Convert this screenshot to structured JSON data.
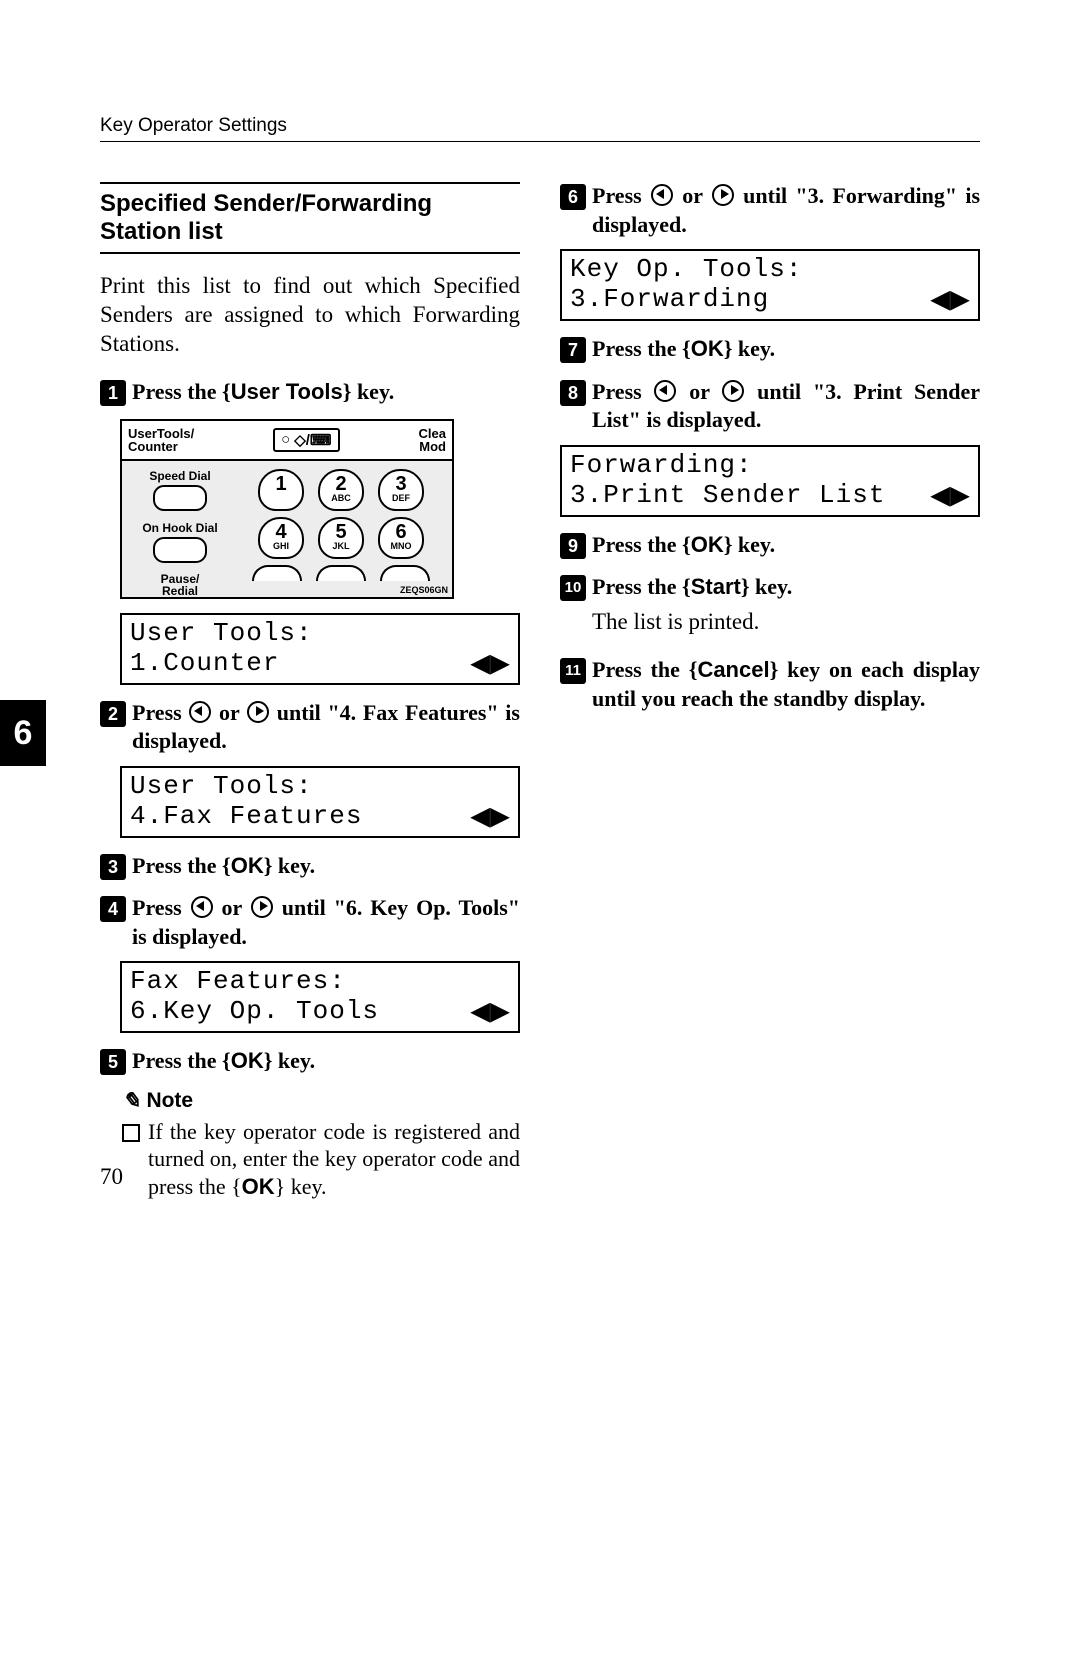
{
  "header": "Key Operator Settings",
  "section_title": "Specified Sender/Forwarding Station list",
  "intro": "Print this list to find out which Specified Senders are assigned to which Forwarding Stations.",
  "chapter_tab": "6",
  "page_number": "70",
  "keypad": {
    "top_label_left": "UserTools/\nCounter",
    "top_label_right": "Clea\nMod",
    "chip_glyph": "◇/⌨",
    "left_labels": [
      "Speed Dial",
      "On Hook Dial",
      "Pause/\nRedial"
    ],
    "keys": [
      {
        "n": "1",
        "sub": ""
      },
      {
        "n": "2",
        "sub": "ABC"
      },
      {
        "n": "3",
        "sub": "DEF"
      },
      {
        "n": "4",
        "sub": "GHI"
      },
      {
        "n": "5",
        "sub": "JKL"
      },
      {
        "n": "6",
        "sub": "MNO"
      }
    ],
    "code": "ZEQS06GN"
  },
  "lcd": {
    "user_tools_1": {
      "l1": "User Tools:",
      "l2": "1.Counter"
    },
    "user_tools_4": {
      "l1": "User Tools:",
      "l2": "4.Fax Features"
    },
    "fax_features_6": {
      "l1": "Fax Features:",
      "l2": "6.Key Op. Tools"
    },
    "key_op_3": {
      "l1": "Key Op. Tools:",
      "l2": "3.Forwarding"
    },
    "fwd_3": {
      "l1": "Forwarding:",
      "l2": "3.Print Sender List"
    }
  },
  "steps": {
    "s1_a": "Press the ",
    "s1_key": "User Tools",
    "s1_b": " key.",
    "s2_a": "Press ",
    "s2_b": " or ",
    "s2_c": " until \"4. Fax Features\" is displayed.",
    "s3_a": "Press the ",
    "s3_key": "OK",
    "s3_b": " key.",
    "s4_a": "Press ",
    "s4_b": " or ",
    "s4_c": " until \"6. Key Op. Tools\" is displayed.",
    "s5_a": "Press the ",
    "s5_key": "OK",
    "s5_b": " key.",
    "s6_a": "Press ",
    "s6_b": " or ",
    "s6_c": " until \"3. Forwarding\" is displayed.",
    "s7_a": "Press the ",
    "s7_key": "OK",
    "s7_b": " key.",
    "s8_a": "Press ",
    "s8_b": " or ",
    "s8_c": " until \"3. Print Sender List\" is displayed.",
    "s9_a": "Press the ",
    "s9_key": "OK",
    "s9_b": " key.",
    "s10_a": "Press the ",
    "s10_key": "Start",
    "s10_b": " key.",
    "s10_result": "The list is printed.",
    "s11_a": "Press the ",
    "s11_key": "Cancel",
    "s11_b": " key on each display until you reach the standby display."
  },
  "note": {
    "heading": "Note",
    "item_a": "If the key operator code is registered and turned on, enter the key operator code and press the ",
    "item_key": "OK",
    "item_b": " key."
  }
}
